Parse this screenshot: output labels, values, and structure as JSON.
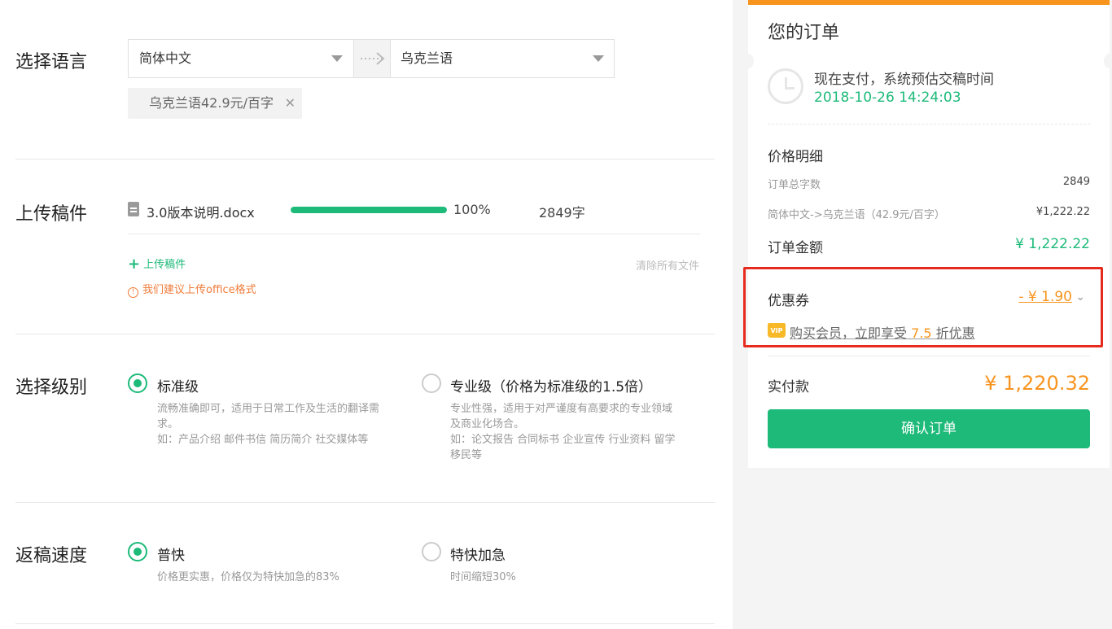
{
  "language": {
    "section_title": "选择语言",
    "source": "简体中文",
    "target": "乌克兰语",
    "price_tag": "乌克兰语42.9元/百字",
    "price_tag_remove": "✕"
  },
  "upload": {
    "section_title": "上传稿件",
    "file": {
      "name": "3.0版本说明.docx",
      "progress": 1.0,
      "percent_text": "100%",
      "word_count": "2849字"
    },
    "upload_link": "上传稿件",
    "clear_all": "清除所有文件",
    "tip": "我们建议上传office格式"
  },
  "level": {
    "section_title": "选择级别",
    "options": [
      {
        "label": "标准级",
        "selected": true,
        "desc1": "流畅准确即可，适用于日常工作及生活的翻译需求。",
        "desc2": "如：产品介绍 邮件书信 简历简介 社交媒体等"
      },
      {
        "label": "专业级（价格为标准级的1.5倍）",
        "selected": false,
        "desc1": "专业性强，适用于对严谨度有高要求的专业领域及商业化场合。",
        "desc2": "如：论文报告 合同标书 企业宣传 行业资料 留学移民等"
      }
    ]
  },
  "speed": {
    "section_title": "返稿速度",
    "options": [
      {
        "label": "普快",
        "selected": true,
        "desc": "价格更实惠，价格仅为特快加急的83%"
      },
      {
        "label": "特快加急",
        "selected": false,
        "desc": "时间缩短30%"
      }
    ]
  },
  "order": {
    "title": "您的订单",
    "estimate_label": "现在支付，系统预估交稿时间",
    "estimate_time": "2018-10-26 14:24:03",
    "price_detail_title": "价格明细",
    "total_words_label": "订单总字数",
    "total_words": "2849",
    "lang_pair_label": "简体中文->乌克兰语（42.9元/百字）",
    "lang_pair_price": "¥1,222.22",
    "amount_label": "订单金额",
    "amount": "¥ 1,222.22",
    "coupon_label": "优惠券",
    "coupon_value": "- ¥ 1.90",
    "vip_badge": "VIP",
    "vip_text_before": "购买会员，立即享受 ",
    "vip_discount": "7.5",
    "vip_text_after": " 折优惠",
    "paid_label": "实付款",
    "paid_amount": "¥ 1,220.32",
    "confirm_button": "确认订单"
  },
  "colors": {
    "accent": "#1dba79",
    "orange": "#f7941d",
    "highlight": "#e62b1e"
  },
  "icons": [
    "file-icon",
    "swap-arrow-icon",
    "chevron-down-icon",
    "plus-icon",
    "info-icon",
    "clock-icon",
    "vip-icon"
  ]
}
